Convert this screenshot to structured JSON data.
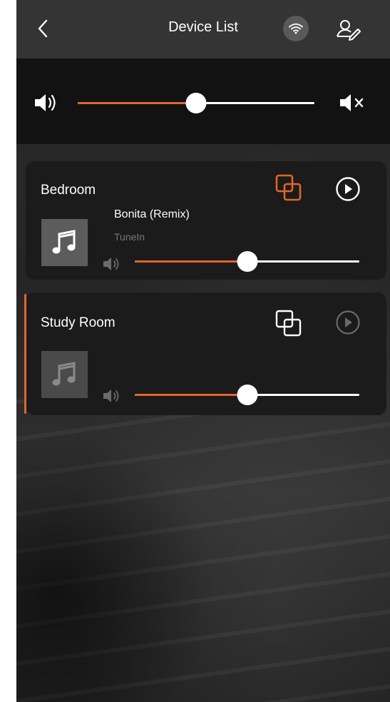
{
  "header": {
    "title": "Device List",
    "back_icon": "chevron-left-icon",
    "wifi_icon": "wifi-icon",
    "account_icon": "user-edit-icon"
  },
  "master_volume": {
    "level": 0.5,
    "volume_icon": "speaker-icon",
    "mute_icon": "speaker-mute-icon"
  },
  "devices": [
    {
      "name": "Bedroom",
      "track_title": "Bonita (Remix)",
      "source": "TuneIn",
      "volume": 0.5,
      "group_icon": "group-devices-icon",
      "group_active": true,
      "play_icon": "play-circle-icon",
      "art_icon": "music-note-icon"
    },
    {
      "name": "Study Room",
      "track_title": "",
      "source": "",
      "volume": 0.5,
      "group_icon": "group-devices-icon",
      "group_active": false,
      "play_icon": "play-circle-icon",
      "art_icon": "music-note-icon",
      "selected": true
    }
  ],
  "colors": {
    "accent": "#e0662a",
    "card_bg": "#1b1b1b",
    "header_bg": "#343434",
    "volume_bar_bg": "#121212"
  }
}
